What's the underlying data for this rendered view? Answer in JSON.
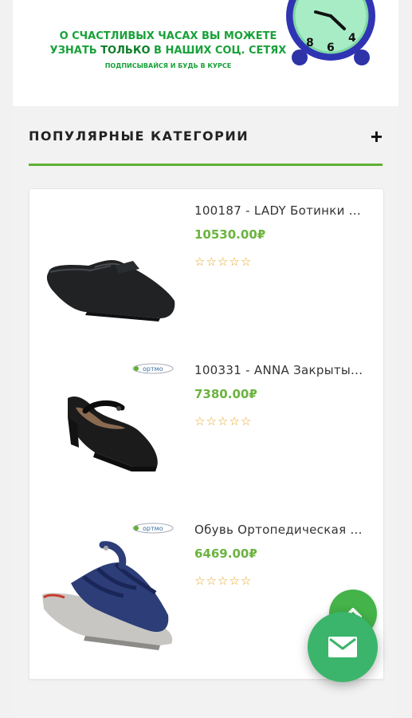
{
  "banner": {
    "line1": "О счастливых часах вы можете",
    "line2_pre": "узнать ",
    "line2_highlight": "только",
    "line2_post": " в наших соц. сетях",
    "line3": "подписывайся и будь в курсе"
  },
  "categories": {
    "title": "ПОПУЛЯРНЫЕ КАТЕГОРИИ",
    "toggle": "+"
  },
  "products": [
    {
      "name": "100187 - LADY Ботинки ...",
      "price": "10530.00₽",
      "rating": 0,
      "brand_badge": false,
      "image": "black-lace-shoe"
    },
    {
      "name": "100331 - ANNA Закрыты...",
      "price": "7380.00₽",
      "rating": 0,
      "brand_badge": true,
      "image": "black-strap-shoe"
    },
    {
      "name": "Обувь Ортопедическая ...",
      "price": "6469.00₽",
      "rating": 0,
      "brand_badge": true,
      "image": "blue-sandal"
    }
  ],
  "badge_text": "ортмо",
  "icons": {
    "scroll_top": "chevron-up-icon",
    "contact": "mail-icon"
  },
  "colors": {
    "accent_green": "#5fb032",
    "price_green": "#6cb33f",
    "star_gold": "#e6a623",
    "fab_green": "#3bb56b"
  }
}
